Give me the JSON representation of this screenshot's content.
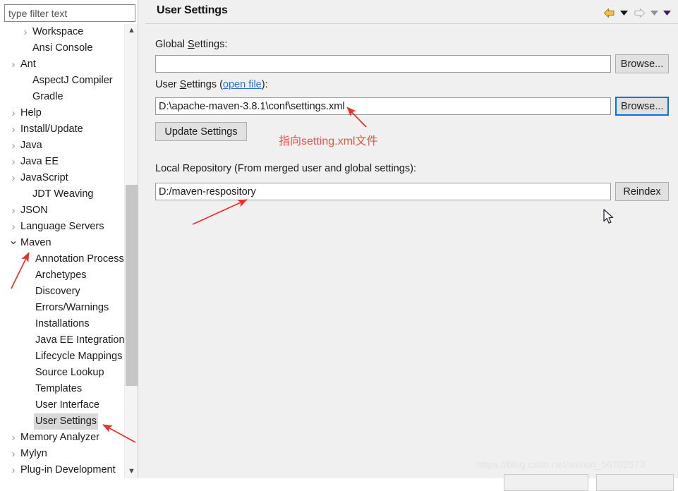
{
  "window": {
    "title": "User Settings"
  },
  "sidebar": {
    "filter": {
      "placeholder": "type filter text",
      "value": ""
    },
    "scrollbar": {
      "up_icon": "chevron-up-icon",
      "down_icon": "chevron-down-icon"
    },
    "items": [
      {
        "label": "Workspace",
        "indent": 1,
        "twisty": "collapsed",
        "selected": false
      },
      {
        "label": "Ansi Console",
        "indent": 1,
        "twisty": "none",
        "selected": false
      },
      {
        "label": "Ant",
        "indent": 0,
        "twisty": "collapsed",
        "selected": false
      },
      {
        "label": "AspectJ Compiler",
        "indent": 1,
        "twisty": "none",
        "selected": false
      },
      {
        "label": "Gradle",
        "indent": 1,
        "twisty": "none",
        "selected": false
      },
      {
        "label": "Help",
        "indent": 0,
        "twisty": "collapsed",
        "selected": false
      },
      {
        "label": "Install/Update",
        "indent": 0,
        "twisty": "collapsed",
        "selected": false
      },
      {
        "label": "Java",
        "indent": 0,
        "twisty": "collapsed",
        "selected": false
      },
      {
        "label": "Java EE",
        "indent": 0,
        "twisty": "collapsed",
        "selected": false
      },
      {
        "label": "JavaScript",
        "indent": 0,
        "twisty": "collapsed",
        "selected": false
      },
      {
        "label": "JDT Weaving",
        "indent": 1,
        "twisty": "none",
        "selected": false
      },
      {
        "label": "JSON",
        "indent": 0,
        "twisty": "collapsed",
        "selected": false
      },
      {
        "label": "Language Servers",
        "indent": 0,
        "twisty": "collapsed",
        "selected": false
      },
      {
        "label": "Maven",
        "indent": 0,
        "twisty": "expanded",
        "selected": false
      },
      {
        "label": "Annotation Processing",
        "indent": 2,
        "twisty": "none",
        "selected": false
      },
      {
        "label": "Archetypes",
        "indent": 2,
        "twisty": "none",
        "selected": false
      },
      {
        "label": "Discovery",
        "indent": 2,
        "twisty": "none",
        "selected": false
      },
      {
        "label": "Errors/Warnings",
        "indent": 2,
        "twisty": "none",
        "selected": false
      },
      {
        "label": "Installations",
        "indent": 2,
        "twisty": "none",
        "selected": false
      },
      {
        "label": "Java EE Integration",
        "indent": 2,
        "twisty": "none",
        "selected": false
      },
      {
        "label": "Lifecycle Mappings",
        "indent": 2,
        "twisty": "none",
        "selected": false
      },
      {
        "label": "Source Lookup",
        "indent": 2,
        "twisty": "none",
        "selected": false
      },
      {
        "label": "Templates",
        "indent": 2,
        "twisty": "none",
        "selected": false
      },
      {
        "label": "User Interface",
        "indent": 2,
        "twisty": "none",
        "selected": false
      },
      {
        "label": "User Settings",
        "indent": 2,
        "twisty": "none",
        "selected": true
      },
      {
        "label": "Memory Analyzer",
        "indent": 0,
        "twisty": "collapsed",
        "selected": false
      },
      {
        "label": "Mylyn",
        "indent": 0,
        "twisty": "collapsed",
        "selected": false
      },
      {
        "label": "Plug-in Development",
        "indent": 0,
        "twisty": "collapsed",
        "selected": false
      }
    ]
  },
  "header": {
    "title": "User Settings",
    "back_icon": "back-arrow-icon",
    "back_menu_icon": "caret-down-icon",
    "forward_icon": "forward-arrow-icon",
    "forward_menu_icon": "caret-down-icon",
    "view_menu_icon": "caret-down-icon",
    "back_color": "#d79b00",
    "forward_color": "#c8c8c8"
  },
  "main": {
    "global_settings": {
      "label_pre": "Global ",
      "label_mnemonic": "S",
      "label_post": "ettings:",
      "value": "",
      "browse_label": "Browse..."
    },
    "user_settings": {
      "label_pre": "User ",
      "label_mnemonic": "S",
      "label_mid": "ettings (",
      "link_label": "open file",
      "label_post": "):",
      "value": "D:\\apache-maven-3.8.1\\conf\\settings.xml",
      "browse_label": "Browse...",
      "update_label": "Update Settings"
    },
    "local_repository": {
      "label": "Local Repository (From merged user and global settings):",
      "value": "D:/maven-respository",
      "reindex_label": "Reindex"
    }
  },
  "annotations": {
    "note_text": "指向setting.xml文件",
    "arrow_color": "#ec2d2d"
  },
  "watermark": {
    "text": "https://blog.csdn.net/weixin_56702673"
  }
}
